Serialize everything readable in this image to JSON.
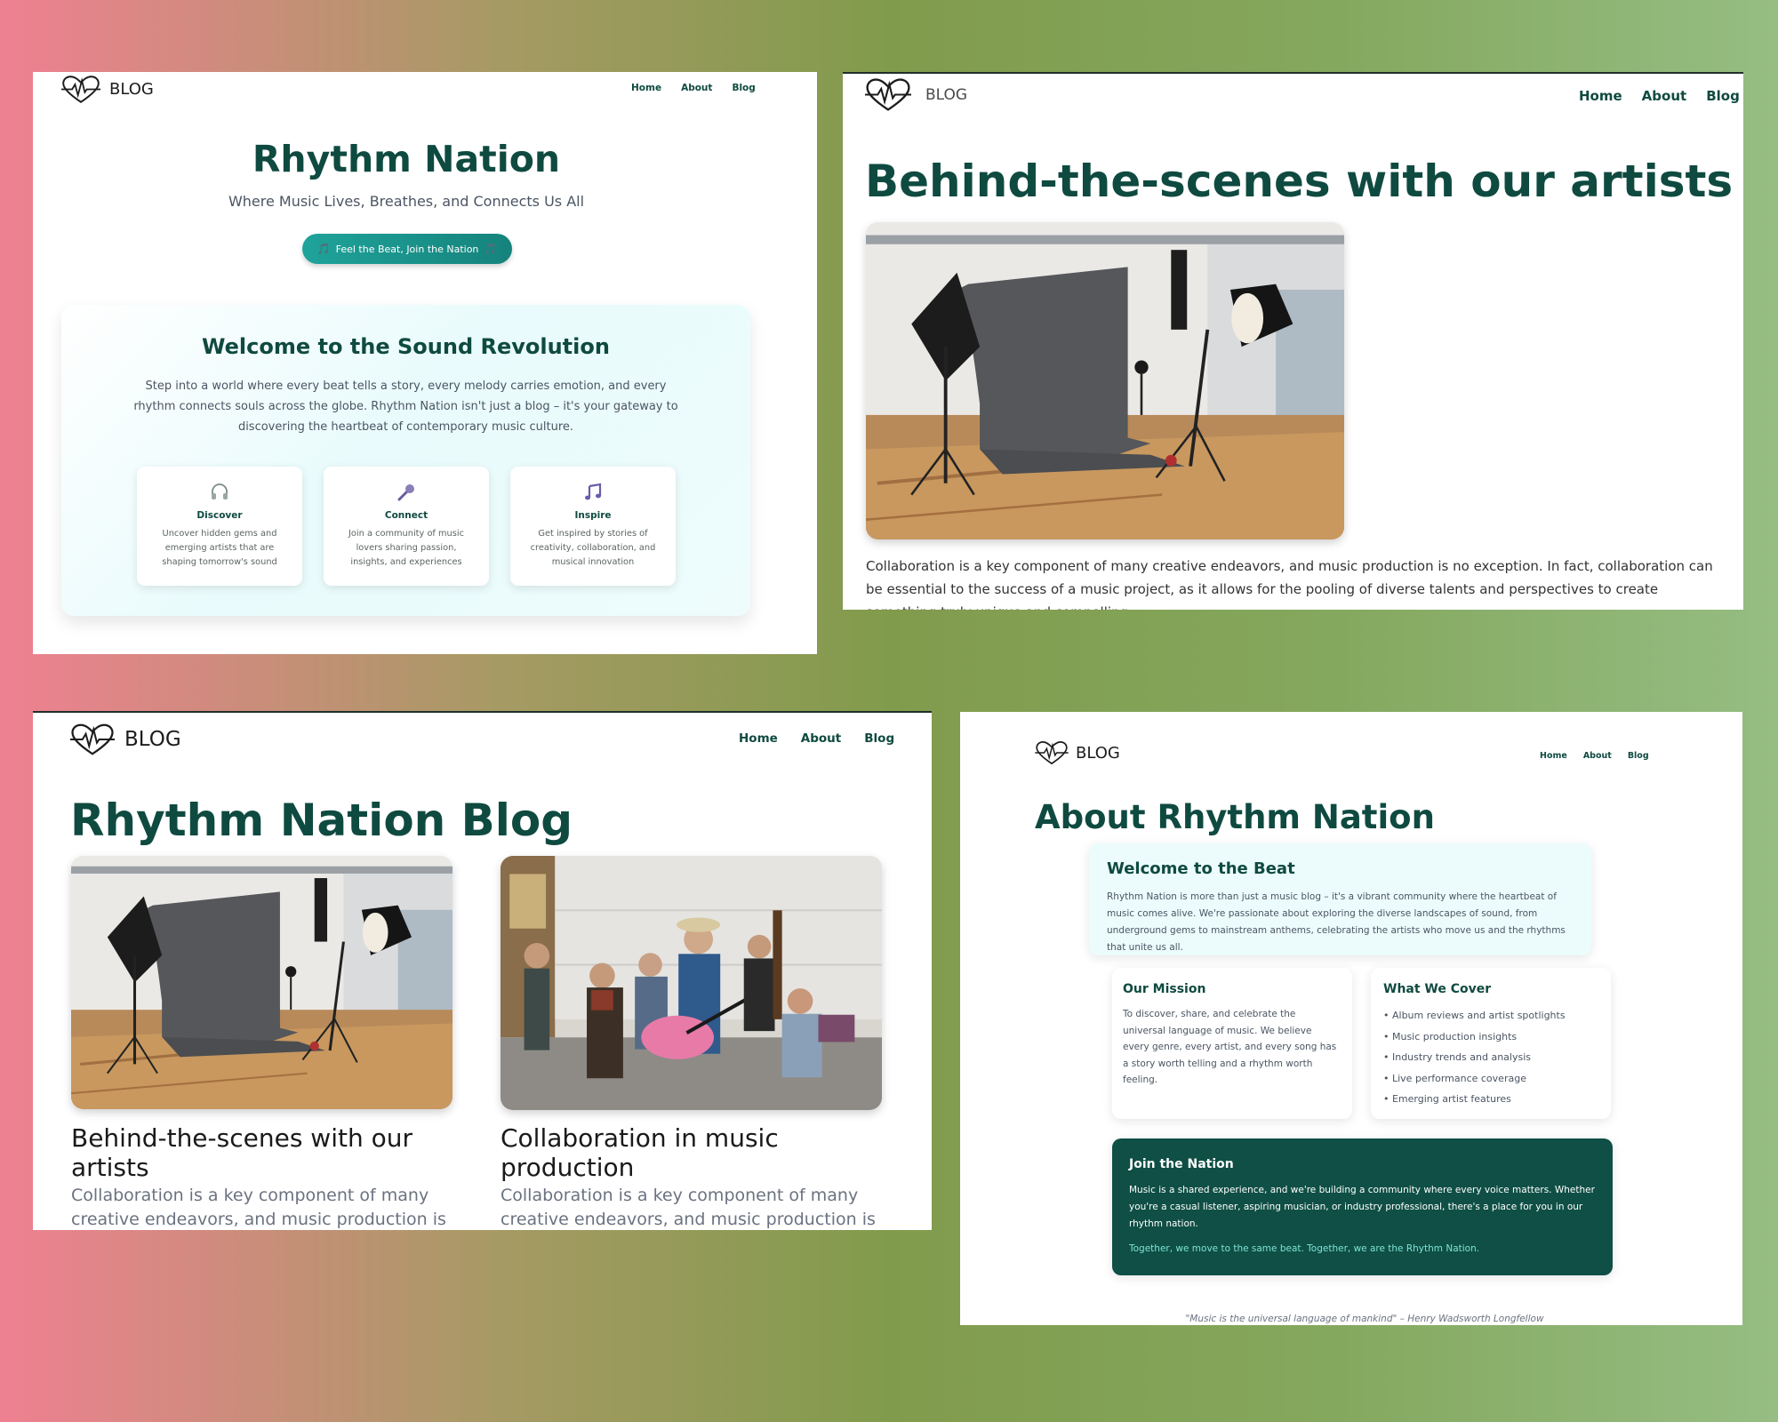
{
  "brand": {
    "logo_text": "BLOG"
  },
  "nav": {
    "home": "Home",
    "about": "About",
    "blog": "Blog"
  },
  "home": {
    "title": "Rhythm Nation",
    "subtitle": "Where Music Lives, Breathes, and Connects Us All",
    "cta": "Feel the Beat, Join the Nation",
    "cta_emoji": "🎵",
    "welcome_title": "Welcome to the Sound Revolution",
    "welcome_text": "Step into a world where every beat tells a story, every melody carries emotion, and every rhythm connects souls across the globe. Rhythm Nation isn't just a blog – it's your gateway to discovering the heartbeat of contemporary music culture.",
    "features": [
      {
        "icon": "headphones-icon",
        "title": "Discover",
        "text": "Uncover hidden gems and emerging artists that are shaping tomorrow's sound"
      },
      {
        "icon": "microphone-icon",
        "title": "Connect",
        "text": "Join a community of music lovers sharing passion, insights, and experiences"
      },
      {
        "icon": "music-notes-icon",
        "title": "Inspire",
        "text": "Get inspired by stories of creativity, collaboration, and musical innovation"
      }
    ]
  },
  "post": {
    "title": "Behind-the-scenes with our artists",
    "body": "Collaboration is a key component of many creative endeavors, and music production is no exception. In fact, collaboration can be essential to the success of a music project, as it allows for the pooling of diverse talents and perspectives to create something truly unique and compelling."
  },
  "blog": {
    "title": "Rhythm Nation Blog",
    "posts": [
      {
        "title": "Behind-the-scenes with our artists",
        "excerpt": "Collaboration is a key component of many creative endeavors, and music production is n..."
      },
      {
        "title": "Collaboration in music production",
        "excerpt": "Collaboration is a key component of many creative endeavors, and music production is n..."
      }
    ]
  },
  "about": {
    "title": "About Rhythm Nation",
    "welcome_title": "Welcome to the Beat",
    "welcome_text": "Rhythm Nation is more than just a music blog – it's a vibrant community where the heartbeat of music comes alive. We're passionate about exploring the diverse landscapes of sound, from underground gems to mainstream anthems, celebrating the artists who move us and the rhythms that unite us all.",
    "mission_title": "Our Mission",
    "mission_text": "To discover, share, and celebrate the universal language of music. We believe every genre, every artist, and every song has a story worth telling and a rhythm worth feeling.",
    "cover_title": "What We Cover",
    "cover_items": [
      "• Album reviews and artist spotlights",
      "• Music production insights",
      "• Industry trends and analysis",
      "• Live performance coverage",
      "• Emerging artist features"
    ],
    "join_title": "Join the Nation",
    "join_text": "Music is a shared experience, and we're building a community where every voice matters. Whether you're a casual listener, aspiring musician, or industry professional, there's a place for you in our rhythm nation.",
    "join_tagline": "Together, we move to the same beat. Together, we are the Rhythm Nation.",
    "quote": "\"Music is the universal language of mankind\" – Henry Wadsworth Longfellow"
  },
  "colors": {
    "primary": "#0f4a40",
    "accent": "#15837c",
    "join_bg": "#0f4f45",
    "join_tagline": "#7fe3d6"
  }
}
